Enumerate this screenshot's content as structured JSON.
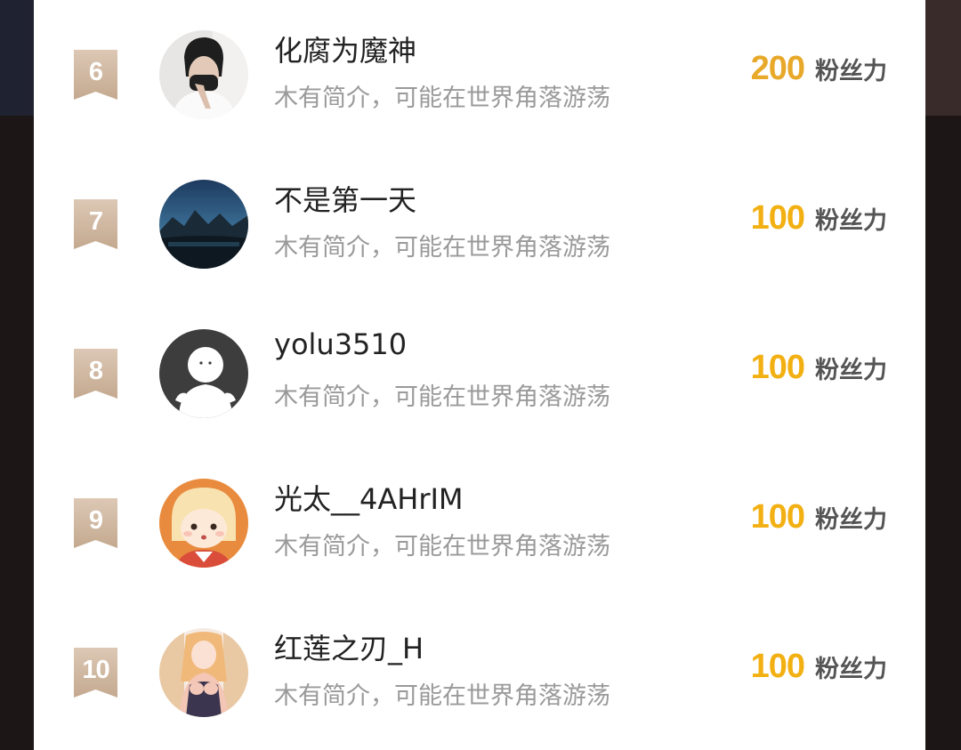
{
  "accent_gold": "#f2b012",
  "accent_gold_top": "#e8a92a",
  "badge_color": "#cbb29c",
  "ranking": [
    {
      "rank": "6",
      "name": "化腐为魔神",
      "bio": "木有简介，可能在世界角落游荡",
      "score": "200",
      "unit": "粉丝力",
      "avatar": "masked-person-avatar"
    },
    {
      "rank": "7",
      "name": "不是第一天",
      "bio": "木有简介，可能在世界角落游荡",
      "score": "100",
      "unit": "粉丝力",
      "avatar": "dusk-landscape-avatar"
    },
    {
      "rank": "8",
      "name": "yolu3510",
      "bio": "木有简介，可能在世界角落游荡",
      "score": "100",
      "unit": "粉丝力",
      "avatar": "default-user-avatar"
    },
    {
      "rank": "9",
      "name": "光太__4AHrIM",
      "bio": "木有简介，可能在世界角落游荡",
      "score": "100",
      "unit": "粉丝力",
      "avatar": "anime-girl-orange-hood-avatar"
    },
    {
      "rank": "10",
      "name": "红莲之刃_H",
      "bio": "木有简介，可能在世界角落游荡",
      "score": "100",
      "unit": "粉丝力",
      "avatar": "anime-girl-dress-avatar"
    }
  ]
}
